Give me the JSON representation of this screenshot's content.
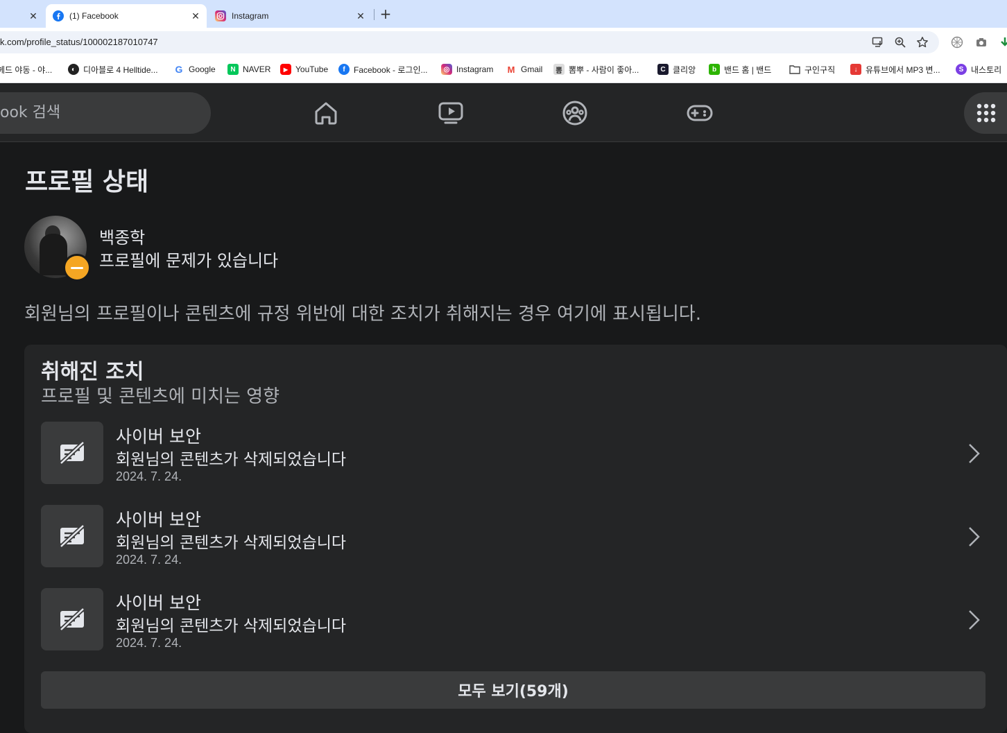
{
  "browser": {
    "tabs": [
      {
        "title": "",
        "active": false
      },
      {
        "title": "(1) Facebook",
        "active": true,
        "icon": "facebook-icon"
      },
      {
        "title": "Instagram",
        "active": false,
        "icon": "instagram-icon"
      }
    ],
    "url": "k.com/profile_status/100002187010747",
    "bookmarks": [
      {
        "label": "헤드 야동 - 야...",
        "icon": "page-icon"
      },
      {
        "label": "디아블로 4 Helltide...",
        "icon": "diablo-icon"
      },
      {
        "label": "Google",
        "icon": "google-icon"
      },
      {
        "label": "NAVER",
        "icon": "naver-icon"
      },
      {
        "label": "YouTube",
        "icon": "youtube-icon"
      },
      {
        "label": "Facebook - 로그인...",
        "icon": "facebook-icon"
      },
      {
        "label": "Instagram",
        "icon": "instagram-icon"
      },
      {
        "label": "Gmail",
        "icon": "gmail-icon"
      },
      {
        "label": "뽐뿌 - 사람이 좋아...",
        "icon": "ppomppu-icon"
      },
      {
        "label": "클리앙",
        "icon": "clien-icon"
      },
      {
        "label": "밴드 홈 | 밴드",
        "icon": "band-icon"
      },
      {
        "label": "구인구직",
        "icon": "folder-icon"
      },
      {
        "label": "유튜브에서 MP3 변...",
        "icon": "download-icon"
      },
      {
        "label": "내스토리",
        "icon": "story-icon"
      }
    ]
  },
  "fb": {
    "search_placeholder": "ook 검색"
  },
  "page": {
    "title": "프로필 상태",
    "user_name": "백종학",
    "user_status": "프로필에 문제가 있습니다",
    "description": "회원님의 프로필이나 콘텐츠에 규정 위반에 대한 조치가 취해지는 경우 여기에 표시됩니다.",
    "card": {
      "title": "취해진 조치",
      "subtitle": "프로필 및 콘텐츠에 미치는 영향",
      "items": [
        {
          "title": "사이버 보안",
          "desc": "회원님의 콘텐츠가 삭제되었습니다",
          "date": "2024. 7. 24."
        },
        {
          "title": "사이버 보안",
          "desc": "회원님의 콘텐츠가 삭제되었습니다",
          "date": "2024. 7. 24."
        },
        {
          "title": "사이버 보안",
          "desc": "회원님의 콘텐츠가 삭제되었습니다",
          "date": "2024. 7. 24."
        }
      ],
      "see_all": "모두 보기(59개)"
    }
  },
  "colors": {
    "badge": "#f5a623",
    "background": "#18191a",
    "card": "#242526"
  }
}
